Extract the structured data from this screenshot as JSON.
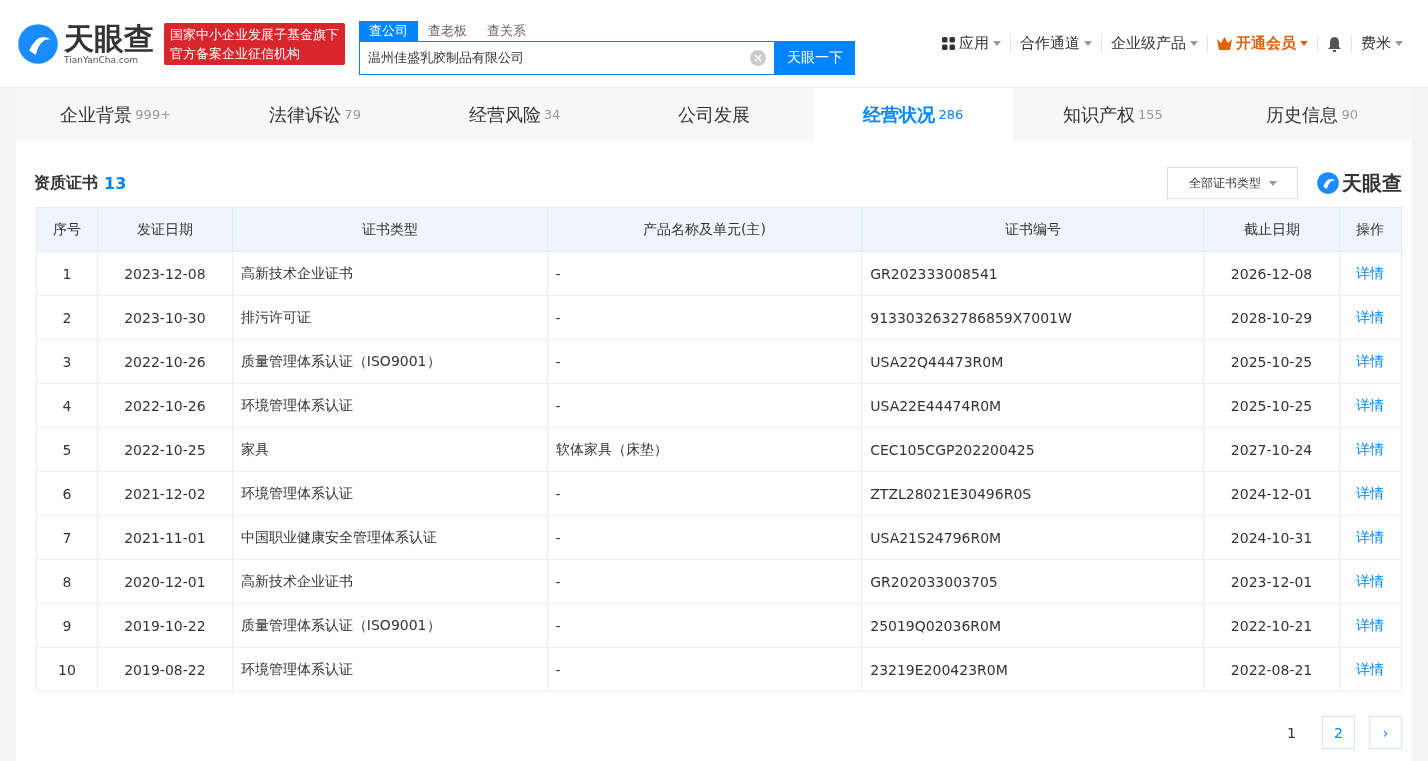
{
  "header": {
    "logo": {
      "name": "天眼查",
      "domain": "TianYanCha.com"
    },
    "badge": [
      "国家中小企业发展子基金旗下",
      "官方备案企业征信机构"
    ],
    "search_tabs": [
      {
        "label": "查公司",
        "selected": true
      },
      {
        "label": "查老板",
        "selected": false
      },
      {
        "label": "查关系",
        "selected": false
      }
    ],
    "search": {
      "value": "温州佳盛乳胶制品有限公司",
      "button": "天眼一下"
    },
    "nav": [
      {
        "label": "应用",
        "kind": "apps"
      },
      {
        "label": "合作通道",
        "kind": "plain"
      },
      {
        "label": "企业级产品",
        "kind": "plain"
      },
      {
        "label": "开通会员",
        "kind": "vip"
      },
      {
        "kind": "bell"
      },
      {
        "label": "费米",
        "kind": "plain"
      }
    ]
  },
  "tabs": [
    {
      "label": "企业背景",
      "count": "999+",
      "selected": false
    },
    {
      "label": "法律诉讼",
      "count": "79",
      "selected": false
    },
    {
      "label": "经营风险",
      "count": "34",
      "selected": false
    },
    {
      "label": "公司发展",
      "selected": false
    },
    {
      "label": "经营状况",
      "count": "286",
      "selected": true
    },
    {
      "label": "知识产权",
      "count": "155",
      "selected": false
    },
    {
      "label": "历史信息",
      "count": "90",
      "selected": false
    }
  ],
  "section": {
    "title": "资质证书",
    "count": "13",
    "filter": "全部证书类型",
    "watermark_logo": "天眼查"
  },
  "table": {
    "columns": [
      "序号",
      "发证日期",
      "证书类型",
      "产品名称及单元(主)",
      "证书编号",
      "截止日期",
      "操作"
    ],
    "rows": [
      [
        "1",
        "2023-12-08",
        "高新技术企业证书",
        "-",
        "GR202333008541",
        "2026-12-08",
        "详情"
      ],
      [
        "2",
        "2023-10-30",
        "排污许可证",
        "-",
        "9133032632786859X7001W",
        "2028-10-29",
        "详情"
      ],
      [
        "3",
        "2022-10-26",
        "质量管理体系认证（ISO9001）",
        "-",
        "USA22Q44473R0M",
        "2025-10-25",
        "详情"
      ],
      [
        "4",
        "2022-10-26",
        "环境管理体系认证",
        "-",
        "USA22E44474R0M",
        "2025-10-25",
        "详情"
      ],
      [
        "5",
        "2022-10-25",
        "家具",
        "软体家具（床垫）",
        "CEC105CGP202200425",
        "2027-10-24",
        "详情"
      ],
      [
        "6",
        "2021-12-02",
        "环境管理体系认证",
        "-",
        "ZTZL28021E30496R0S",
        "2024-12-01",
        "详情"
      ],
      [
        "7",
        "2021-11-01",
        "中国职业健康安全管理体系认证",
        "-",
        "USA21S24796R0M",
        "2024-10-31",
        "详情"
      ],
      [
        "8",
        "2020-12-01",
        "高新技术企业证书",
        "-",
        "GR202033003705",
        "2023-12-01",
        "详情"
      ],
      [
        "9",
        "2019-10-22",
        "质量管理体系认证（ISO9001）",
        "-",
        "25019Q02036R0M",
        "2022-10-21",
        "详情"
      ],
      [
        "10",
        "2019-08-22",
        "环境管理体系认证",
        "-",
        "23219E200423R0M",
        "2022-08-21",
        "详情"
      ]
    ]
  },
  "pagination": {
    "pages": [
      {
        "label": "1",
        "selected": true
      },
      {
        "label": "2",
        "selected": false
      }
    ],
    "next": "›"
  }
}
